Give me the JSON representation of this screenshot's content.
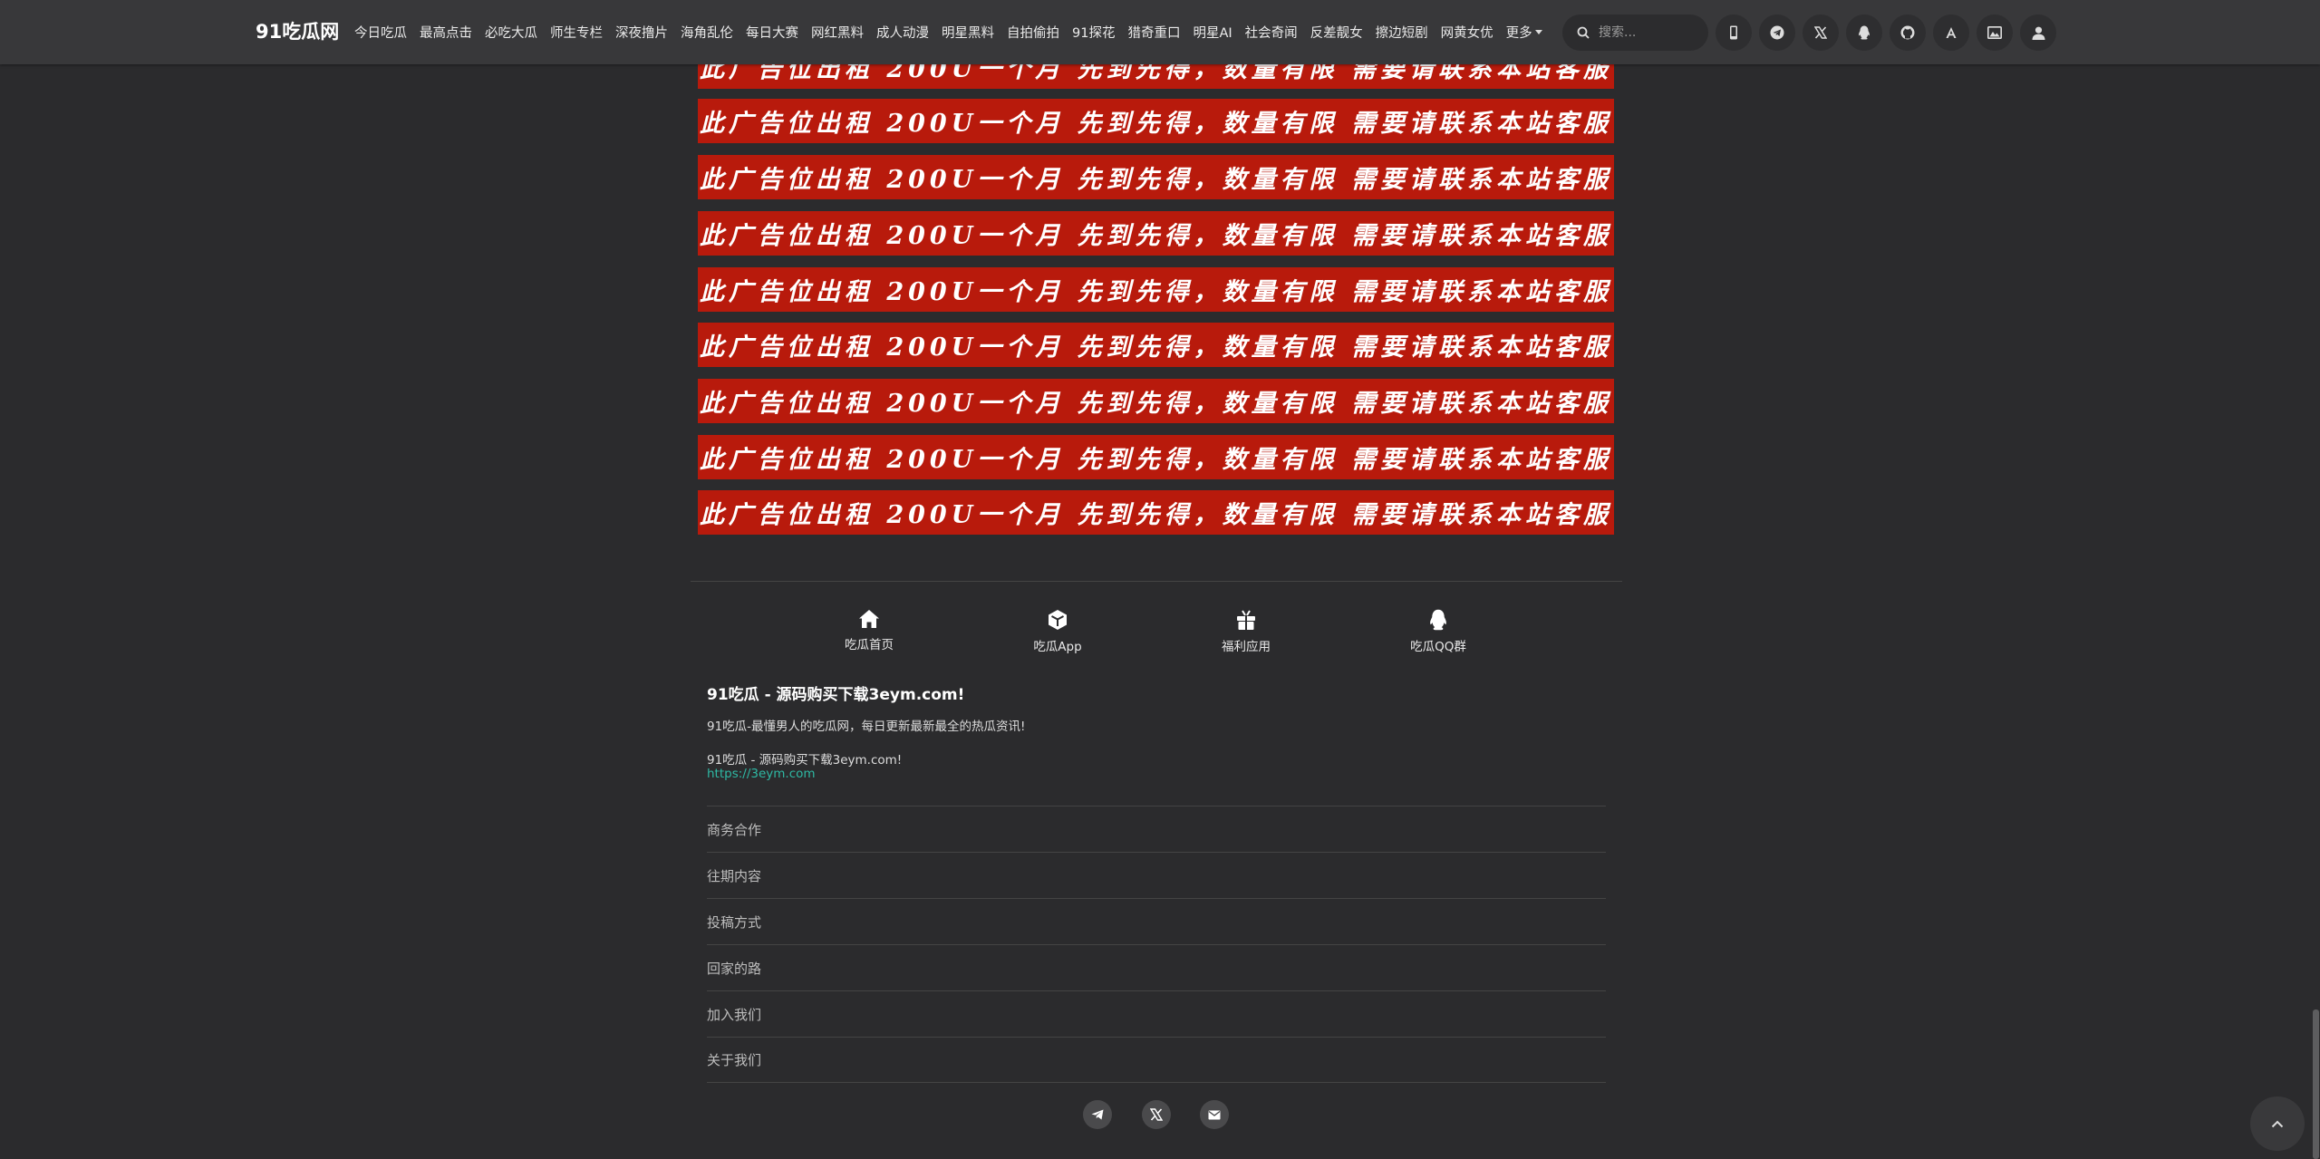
{
  "header": {
    "logo": "91吃瓜网",
    "nav": [
      "今日吃瓜",
      "最高点击",
      "必吃大瓜",
      "师生专栏",
      "深夜撸片",
      "海角乱伦",
      "每日大赛",
      "网红黑料",
      "成人动漫",
      "明星黑料",
      "自拍偷拍",
      "91探花",
      "猎奇重口",
      "明星AI",
      "社会奇闻",
      "反差靓女",
      "擦边短剧",
      "网黄女优"
    ],
    "more_label": "更多",
    "search_placeholder": "搜索...",
    "icons": [
      "mobile-icon",
      "telegram-icon",
      "x-icon",
      "qq-icon",
      "github-icon",
      "font-icon",
      "image-icon",
      "user-icon"
    ]
  },
  "ads": {
    "text": "此广告位出租 200U一个月 先到先得，数量有限 需要请联系本站客服",
    "count": 9
  },
  "footer": {
    "links": [
      {
        "icon": "home-icon",
        "label": "吃瓜首页"
      },
      {
        "icon": "cube-icon",
        "label": "吃瓜App"
      },
      {
        "icon": "gift-icon",
        "label": "福利应用"
      },
      {
        "icon": "qq-icon",
        "label": "吃瓜QQ群"
      }
    ],
    "title": "91吃瓜 - 源码购买下载3eym.com!",
    "desc": "91吃瓜-最懂男人的吃瓜网，每日更新最新最全的热瓜资讯!",
    "line": "91吃瓜 - 源码购买下载3eym.com!",
    "link": "https://3eym.com",
    "menu": [
      "商务合作",
      "往期内容",
      "投稿方式",
      "回家的路",
      "加入我们",
      "关于我们"
    ],
    "social": [
      "telegram-icon",
      "x-icon",
      "mail-icon"
    ]
  },
  "colors": {
    "ad_red": "#b81a0c",
    "link_teal": "#2eb9a4",
    "bg": "#2b2b2d",
    "header": "#38383a"
  }
}
